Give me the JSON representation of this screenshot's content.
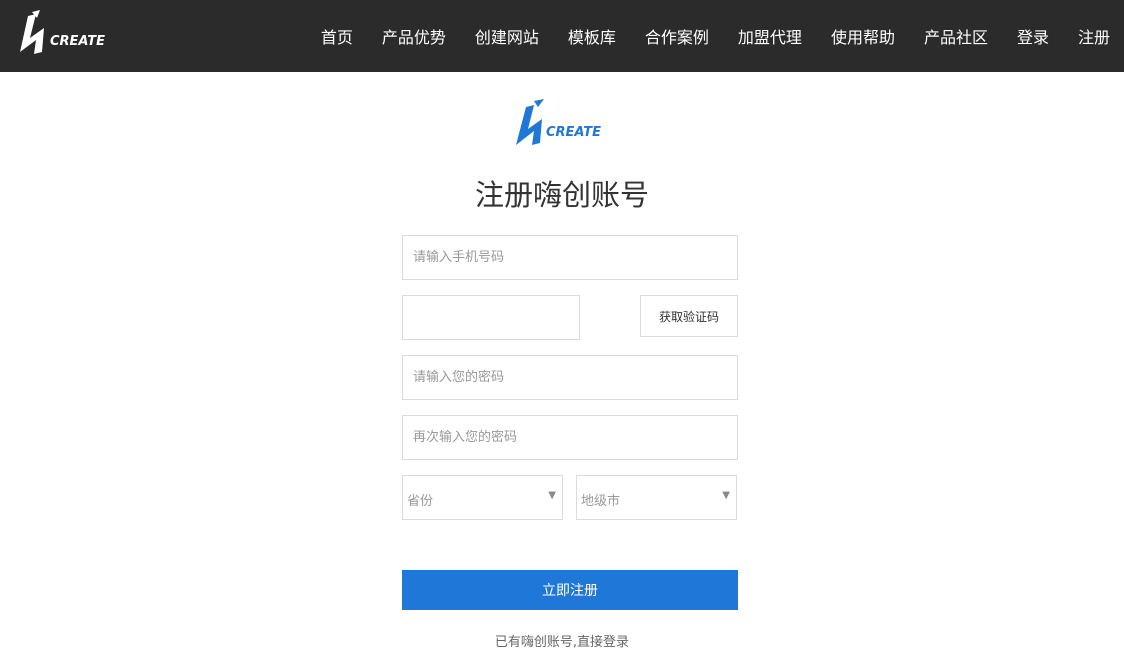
{
  "header": {
    "logo_text": "CREATE",
    "nav_items": [
      "首页",
      "产品优势",
      "创建网站",
      "模板库",
      "合作案例",
      "加盟代理",
      "使用帮助",
      "产品社区",
      "登录",
      "注册"
    ]
  },
  "main": {
    "logo_text": "CREATE",
    "title": "注册嗨创账号",
    "phone_placeholder": "请输入手机号码",
    "code_button_label": "获取验证码",
    "password_placeholder": "请输入您的密码",
    "password_confirm_placeholder": "再次输入您的密码",
    "province_label": "省份",
    "city_label": "地级市",
    "submit_label": "立即注册",
    "login_link": "已有嗨创账号,直接登录"
  },
  "colors": {
    "topbar_bg": "#2b2b2b",
    "brand_blue": "#1f78d8"
  },
  "icons": {
    "select_arrow": "caret-down-icon"
  }
}
